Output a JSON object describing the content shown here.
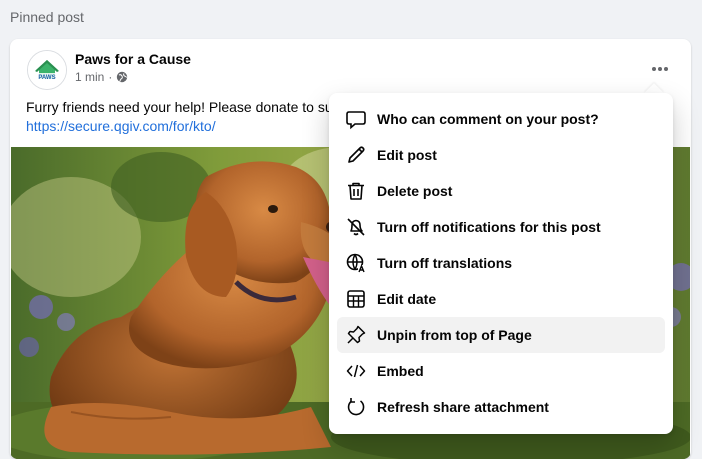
{
  "section": {
    "label": "Pinned post"
  },
  "post": {
    "page_name": "Paws for a Cause",
    "time": "1 min",
    "audience_icon": "globe-icon",
    "text": "Furry friends need your help! Please donate to su",
    "link": "https://secure.qgiv.com/for/kto/",
    "more_icon": "more-options-icon",
    "avatar_text": "PAWS"
  },
  "menu": {
    "items": [
      {
        "label": "Who can comment on your post?",
        "icon": "comment-icon"
      },
      {
        "label": "Edit post",
        "icon": "pencil-icon"
      },
      {
        "label": "Delete post",
        "icon": "trash-icon"
      },
      {
        "label": "Turn off notifications for this post",
        "icon": "bell-off-icon"
      },
      {
        "label": "Turn off translations",
        "icon": "translate-globe-icon"
      },
      {
        "label": "Edit date",
        "icon": "calendar-icon"
      },
      {
        "label": "Unpin from top of Page",
        "icon": "pin-icon",
        "highlighted": true
      },
      {
        "label": "Embed",
        "icon": "code-icon"
      },
      {
        "label": "Refresh share attachment",
        "icon": "refresh-icon"
      }
    ]
  },
  "colors": {
    "link": "#216fdb",
    "secondary_text": "#65676b",
    "menu_hover": "#f2f2f2",
    "background": "#f0f2f5"
  }
}
